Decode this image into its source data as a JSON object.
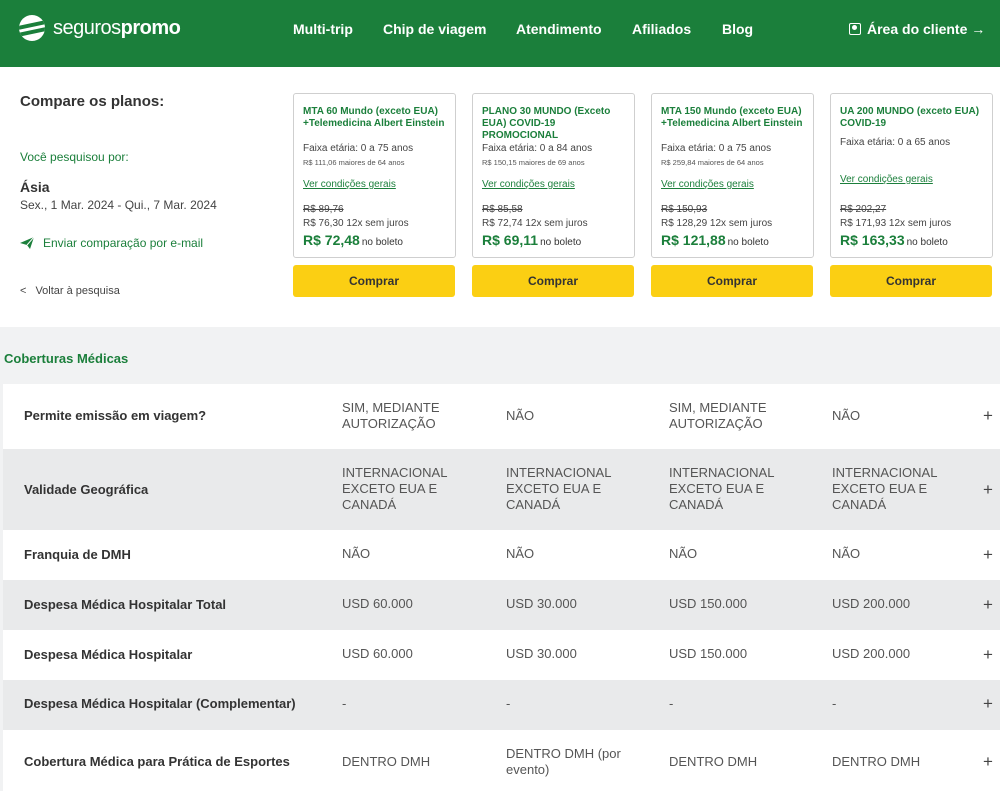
{
  "header": {
    "logo_part1": "seguros",
    "logo_part2": "promo",
    "nav": [
      "Multi-trip",
      "Chip de viagem",
      "Atendimento",
      "Afiliados",
      "Blog"
    ],
    "client_area": "Área do cliente →"
  },
  "sidebar": {
    "title": "Compare os planos:",
    "searched_label": "Você pesquisou por:",
    "destination": "Ásia",
    "dates": "Sex., 1 Mar. 2024 - Qui., 7 Mar. 2024",
    "send_email": "Enviar comparação por e-mail",
    "back": "Voltar à pesquisa",
    "back_chevron": "<"
  },
  "plans": [
    {
      "title": "MTA 60 Mundo (exceto EUA) +Telemedicina Albert Einstein",
      "age": "Faixa etária: 0 a 75 anos",
      "age_fee": "R$ 111,06 maiores de 64 anos",
      "conditions": "Ver condições gerais",
      "old_price": "R$ 89,76",
      "installments": "R$ 76,30 12x sem juros",
      "price": "R$ 72,48",
      "price_suffix": "no boleto",
      "buy": "Comprar"
    },
    {
      "title": "PLANO 30 MUNDO (Exceto EUA) COVID-19 PROMOCIONAL",
      "age": "Faixa etária: 0 a 84 anos",
      "age_fee": "R$ 150,15 maiores de 69 anos",
      "conditions": "Ver condições gerais",
      "old_price": "R$ 85,58",
      "installments": "R$ 72,74 12x sem juros",
      "price": "R$ 69,11",
      "price_suffix": "no boleto",
      "buy": "Comprar"
    },
    {
      "title": "MTA 150 Mundo (exceto EUA) +Telemedicina Albert Einstein",
      "age": "Faixa etária: 0 a 75 anos",
      "age_fee": "R$ 259,84 maiores de 64 anos",
      "conditions": "Ver condições gerais",
      "old_price": "R$ 150,93",
      "installments": "R$ 128,29 12x sem juros",
      "price": "R$ 121,88",
      "price_suffix": "no boleto",
      "buy": "Comprar"
    },
    {
      "title": "UA 200 MUNDO (exceto EUA) COVID-19",
      "age": "Faixa etária: 0 a 65 anos",
      "age_fee": "",
      "conditions": "Ver condições gerais",
      "old_price": "R$ 202,27",
      "installments": "R$ 171,93 12x sem juros",
      "price": "R$ 163,33",
      "price_suffix": "no boleto",
      "buy": "Comprar"
    }
  ],
  "coverage": {
    "section_title": "Coberturas Médicas",
    "expand_symbol": "+",
    "rows": [
      {
        "label": "Permite emissão em viagem?",
        "values": [
          "SIM, MEDIANTE AUTORIZAÇÃO",
          "NÃO",
          "SIM, MEDIANTE AUTORIZAÇÃO",
          "NÃO"
        ]
      },
      {
        "label": "Validade Geográfica",
        "values": [
          "INTERNACIONAL EXCETO EUA E CANADÁ",
          "INTERNACIONAL EXCETO EUA E CANADÁ",
          "INTERNACIONAL EXCETO EUA E CANADÁ",
          "INTERNACIONAL EXCETO EUA E CANADÁ"
        ]
      },
      {
        "label": "Franquia de DMH",
        "values": [
          "NÃO",
          "NÃO",
          "NÃO",
          "NÃO"
        ]
      },
      {
        "label": "Despesa Médica Hospitalar Total",
        "values": [
          "USD 60.000",
          "USD 30.000",
          "USD 150.000",
          "USD 200.000"
        ]
      },
      {
        "label": "Despesa Médica Hospitalar",
        "values": [
          "USD 60.000",
          "USD 30.000",
          "USD 150.000",
          "USD 200.000"
        ]
      },
      {
        "label": "Despesa Médica Hospitalar (Complementar)",
        "values": [
          "-",
          "-",
          "-",
          "-"
        ]
      },
      {
        "label": "Cobertura Médica para Prática de Esportes",
        "values": [
          "DENTRO DMH",
          "DENTRO DMH (por evento)",
          "DENTRO DMH",
          "DENTRO DMH"
        ]
      }
    ]
  },
  "colors": {
    "brand_green": "#1b7f3b",
    "buy_yellow": "#fbcf13"
  }
}
